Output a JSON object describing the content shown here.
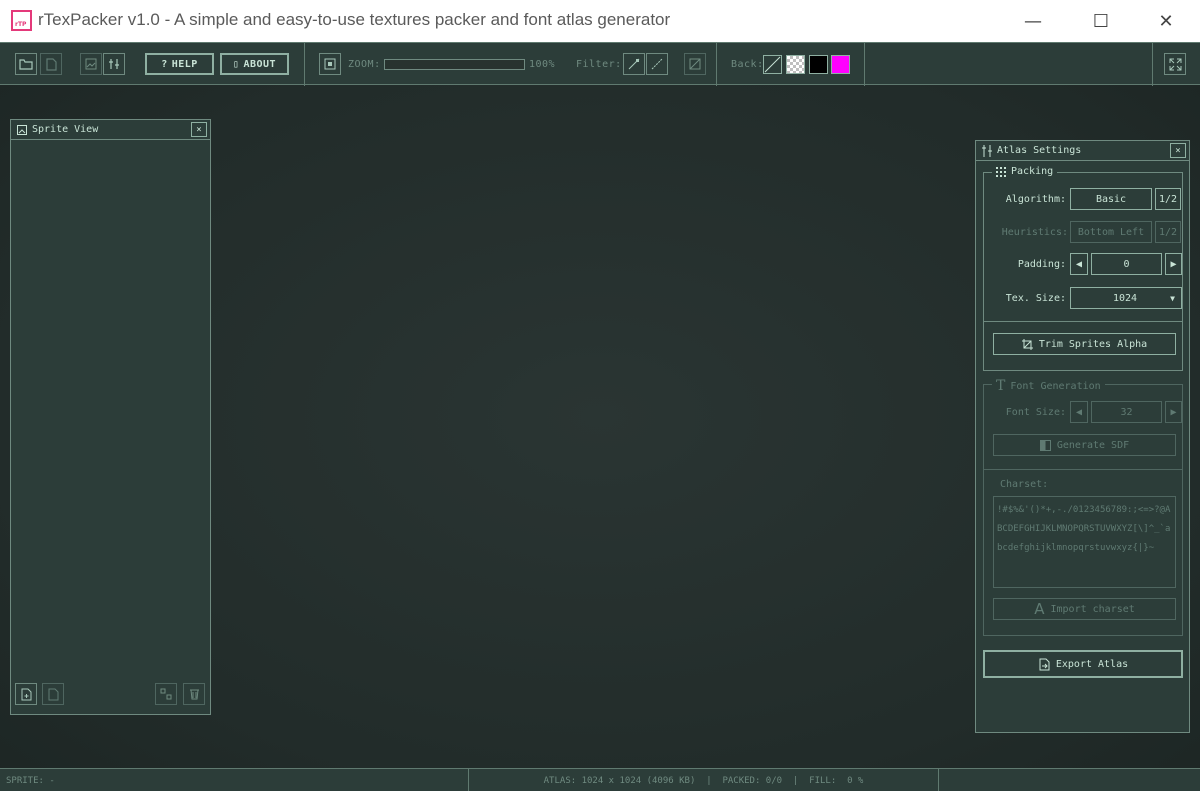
{
  "window": {
    "app_icon_text": "rTP",
    "title": "rTexPacker v1.0 - A simple and easy-to-use textures packer and font atlas generator",
    "minimize": "—",
    "maximize": "☐",
    "close": "✕"
  },
  "toolbar": {
    "help_label": "HELP",
    "about_label": "ABOUT",
    "zoom_label": "ZOOM:",
    "zoom_value": "100%",
    "zoom_level": 0,
    "filter_label": "Filter:",
    "back_label": "Back:",
    "colors": {
      "black": "#000000",
      "magenta": "#ff00ff"
    }
  },
  "sprite_view": {
    "title": "Sprite View",
    "close": "×"
  },
  "atlas_settings": {
    "title": "Atlas Settings",
    "close": "×",
    "packing": {
      "title": "Packing",
      "algorithm_label": "Algorithm:",
      "algorithm_value": "Basic",
      "algorithm_page": "1/2",
      "heuristics_label": "Heuristics:",
      "heuristics_value": "Bottom Left",
      "heuristics_page": "1/2",
      "padding_label": "Padding:",
      "padding_value": "0",
      "tex_size_label": "Tex. Size:",
      "tex_size_value": "1024",
      "trim_label": "Trim Sprites Alpha"
    },
    "font_generation": {
      "title": "Font Generation",
      "font_size_label": "Font Size:",
      "font_size_value": "32",
      "generate_sdf_label": "Generate SDF",
      "charset_label": "Charset:",
      "charset_value": "!#$%&'()*+,-./0123456789:;<=>?@ABCDEFGHIJKLMNOPQRSTUVWXYZ[\\]^_`abcdefghijklmnopqrstuvwxyz{|}~",
      "import_label": "Import charset"
    },
    "export_label": "Export Atlas"
  },
  "statusbar": {
    "sprite": "SPRITE: -",
    "atlas": "ATLAS: 1024 x 1024 (4096 KB)  |  PACKED: 0/0  |  FILL:  0 %"
  }
}
